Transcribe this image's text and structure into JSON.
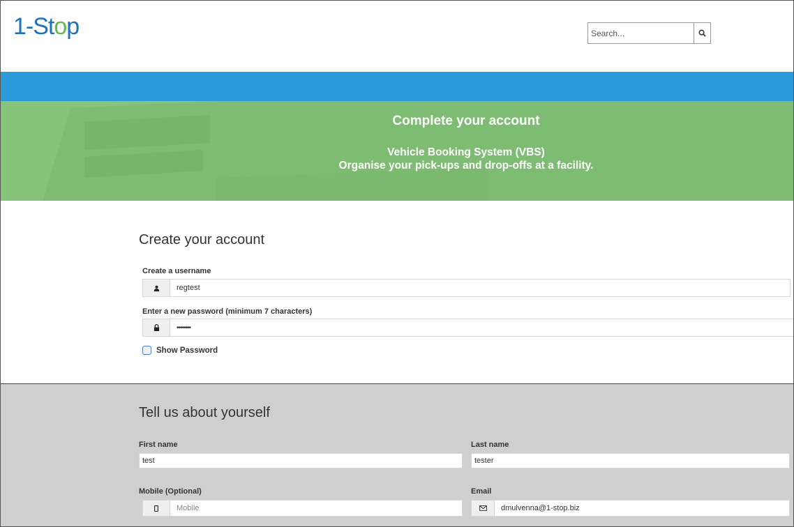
{
  "logo": {
    "text_1": "1-St",
    "text_o": "o",
    "text_2": "p"
  },
  "search": {
    "placeholder": "Search...",
    "icon": "search-icon"
  },
  "banner": {
    "title": "Complete your account",
    "subtitle_line1": "Vehicle Booking System (VBS)",
    "subtitle_line2": "Organise your pick-ups and drop-offs at a facility."
  },
  "account": {
    "heading": "Create your account",
    "username_label": "Create a username",
    "username_value": "regtest",
    "username_icon": "user-icon",
    "password_label": "Enter a new password (minimum 7 characters)",
    "password_value": "••••••••",
    "password_icon": "lock-icon",
    "show_password_label": "Show Password",
    "show_password_checked": false
  },
  "about": {
    "heading": "Tell us about yourself",
    "first_name_label": "First name",
    "first_name_value": "test",
    "last_name_label": "Last name",
    "last_name_value": "tester",
    "mobile_label": "Mobile (Optional)",
    "mobile_placeholder": "Mobile",
    "mobile_icon": "mobile-icon",
    "email_label": "Email",
    "email_value": "dmulvenna@1-stop.biz",
    "email_icon": "envelope-icon"
  },
  "colors": {
    "brand_blue": "#2b9ad8",
    "banner_green": "#86c47a",
    "logo_blue": "#1e73b8",
    "logo_green": "#5fba46"
  }
}
